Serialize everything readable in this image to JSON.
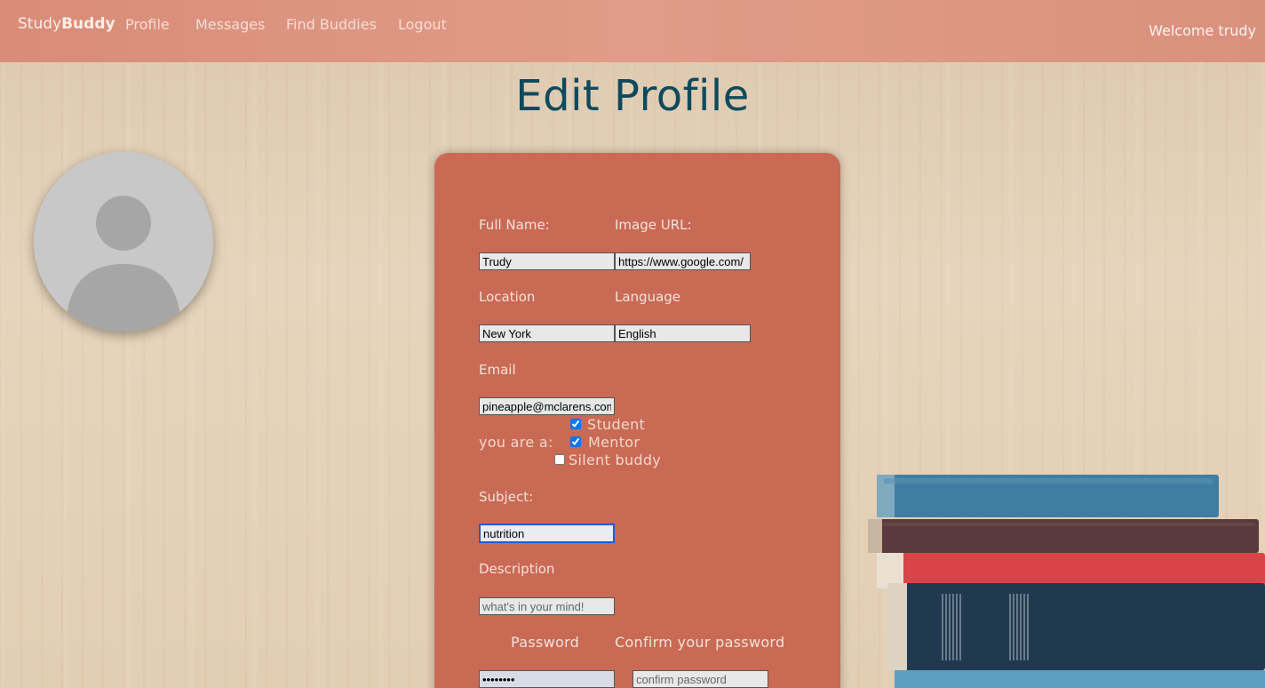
{
  "nav": {
    "brand_part1": "Study",
    "brand_part2": "Buddy",
    "links": [
      "Profile",
      "Messages",
      "Find Buddies",
      "Logout"
    ],
    "welcome": "Welcome trudy"
  },
  "page": {
    "title": "Edit Profile"
  },
  "form": {
    "full_name": {
      "label": "Full Name:",
      "value": "Trudy"
    },
    "image_url": {
      "label": "Image URL:",
      "value": "https://www.google.com/"
    },
    "location": {
      "label": "Location",
      "value": "New York"
    },
    "language": {
      "label": "Language",
      "value": "English"
    },
    "email": {
      "label": "Email",
      "value": "pineapple@mclarens.com"
    },
    "role": {
      "label": "you are a:",
      "options": [
        {
          "label": "Student",
          "checked": true
        },
        {
          "label": "Mentor",
          "checked": true
        },
        {
          "label": "Silent buddy",
          "checked": false
        }
      ]
    },
    "subject": {
      "label": "Subject:",
      "value": "nutrition"
    },
    "description": {
      "label": "Description",
      "value": "",
      "placeholder": "what's in your mind!"
    },
    "password": {
      "label": "Password",
      "value": "••••••••"
    },
    "confirm_password": {
      "label": "Confirm your password",
      "value": "",
      "placeholder": "confirm password"
    }
  },
  "colors": {
    "navbar": "#d98c78",
    "card": "#c96a55",
    "title": "#0f4a5c",
    "focus": "#1a5fd0"
  },
  "icons": {
    "avatar": "default-user-icon"
  }
}
